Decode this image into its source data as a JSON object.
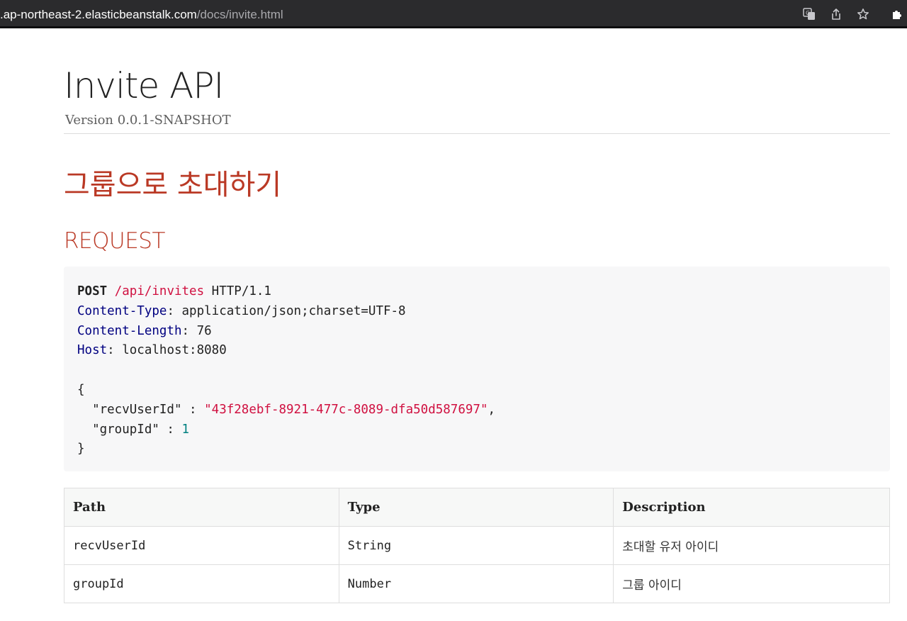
{
  "browser": {
    "url_host": ".ap-northeast-2.elasticbeanstalk.com",
    "url_path": "/docs/invite.html",
    "icons": [
      "translate-icon",
      "share-icon",
      "bookmark-star-icon",
      "extensions-icon"
    ]
  },
  "doc": {
    "title": "Invite API",
    "version": "Version 0.0.1-SNAPSHOT"
  },
  "section": {
    "title": "그룹으로 초대하기",
    "subtitle": "REQUEST"
  },
  "request": {
    "method": "POST",
    "path": "/api/invites",
    "protocol": " HTTP/1.1",
    "headers": [
      {
        "name": "Content-Type",
        "value": ": application/json;charset=UTF-8"
      },
      {
        "name": "Content-Length",
        "value": ": 76"
      },
      {
        "name": "Host",
        "value": ": localhost:8080"
      }
    ],
    "body_open": "{",
    "body_key1": "  \"recvUserId\" : ",
    "body_val1": "\"43f28ebf-8921-477c-8089-dfa50d587697\"",
    "body_sep1": ",",
    "body_key2": "  \"groupId\" : ",
    "body_val2": "1",
    "body_close": "}"
  },
  "fields_table": {
    "headers": [
      "Path",
      "Type",
      "Description"
    ],
    "rows": [
      {
        "path": "recvUserId",
        "type": "String",
        "description": "초대할 유저 아이디"
      },
      {
        "path": "groupId",
        "type": "Number",
        "description": "그룹 아이디"
      }
    ]
  },
  "colors": {
    "accent_red": "#ba3925",
    "string_red": "#d01040",
    "header_navy": "#000080",
    "number_teal": "#008080"
  }
}
